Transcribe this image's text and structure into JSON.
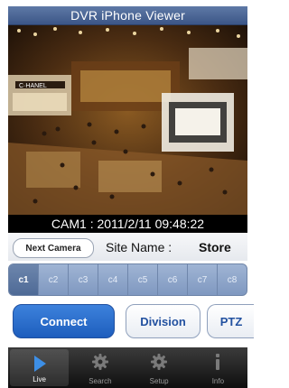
{
  "app": {
    "title": "DVR iPhone Viewer"
  },
  "camera_status": "CAM1 : 2011/2/11 09:48:22",
  "controls": {
    "next_camera": "Next Camera",
    "site_label": "Site Name :",
    "site_value": "Store"
  },
  "channels": [
    "c1",
    "c2",
    "c3",
    "c4",
    "c5",
    "c6",
    "c7",
    "c8"
  ],
  "active_channel": "c1",
  "actions": {
    "connect": "Connect",
    "division": "Division",
    "ptz": "PTZ"
  },
  "tabs": [
    {
      "label": "Live",
      "icon": "play-icon",
      "active": true
    },
    {
      "label": "Search",
      "icon": "gear-icon",
      "active": false
    },
    {
      "label": "Setup",
      "icon": "gear-icon",
      "active": false
    },
    {
      "label": "Info",
      "icon": "info-icon",
      "active": false
    }
  ],
  "colors": {
    "title_bar": "#4a6595",
    "accent": "#2a6ccf",
    "channel_active": "#5b76a2"
  }
}
